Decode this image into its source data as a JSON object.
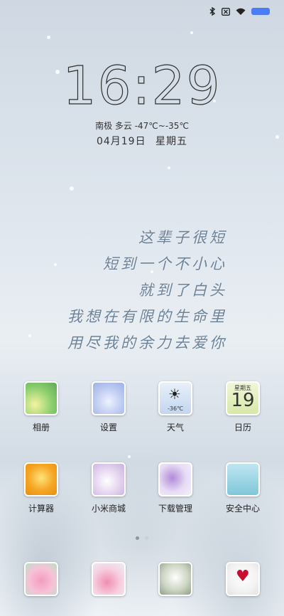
{
  "status": {
    "icons": [
      "bluetooth-icon",
      "sim-off-icon",
      "wifi-icon",
      "battery-icon"
    ]
  },
  "lockscreen": {
    "time_hours": "16",
    "time_minutes": "29",
    "weather": "南极 多云 -47℃~-35℃",
    "date": "04月19日",
    "weekday": "星期五"
  },
  "poem": [
    "这辈子很短",
    "短到一个不小心",
    "就到了白头",
    "我想在有限的生命里",
    "用尽我的余力去爱你"
  ],
  "apps_row1": [
    {
      "label": "相册",
      "icon": "photos-icon"
    },
    {
      "label": "设置",
      "icon": "settings-icon"
    },
    {
      "label": "天气",
      "icon": "weather-icon",
      "temp": "-36℃"
    },
    {
      "label": "日历",
      "icon": "calendar-icon",
      "weekday": "星期五",
      "day": "19"
    }
  ],
  "apps_row2": [
    {
      "label": "计算器",
      "icon": "calculator-icon"
    },
    {
      "label": "小米商城",
      "icon": "mi-store-icon"
    },
    {
      "label": "下载管理",
      "icon": "download-icon"
    },
    {
      "label": "安全中心",
      "icon": "security-icon"
    }
  ],
  "dock": [
    {
      "icon": "dock-app-1-icon"
    },
    {
      "icon": "dock-app-2-icon"
    },
    {
      "icon": "dock-app-3-icon"
    },
    {
      "icon": "dock-app-4-icon"
    }
  ],
  "pager": {
    "pages": 2,
    "current": 1
  }
}
